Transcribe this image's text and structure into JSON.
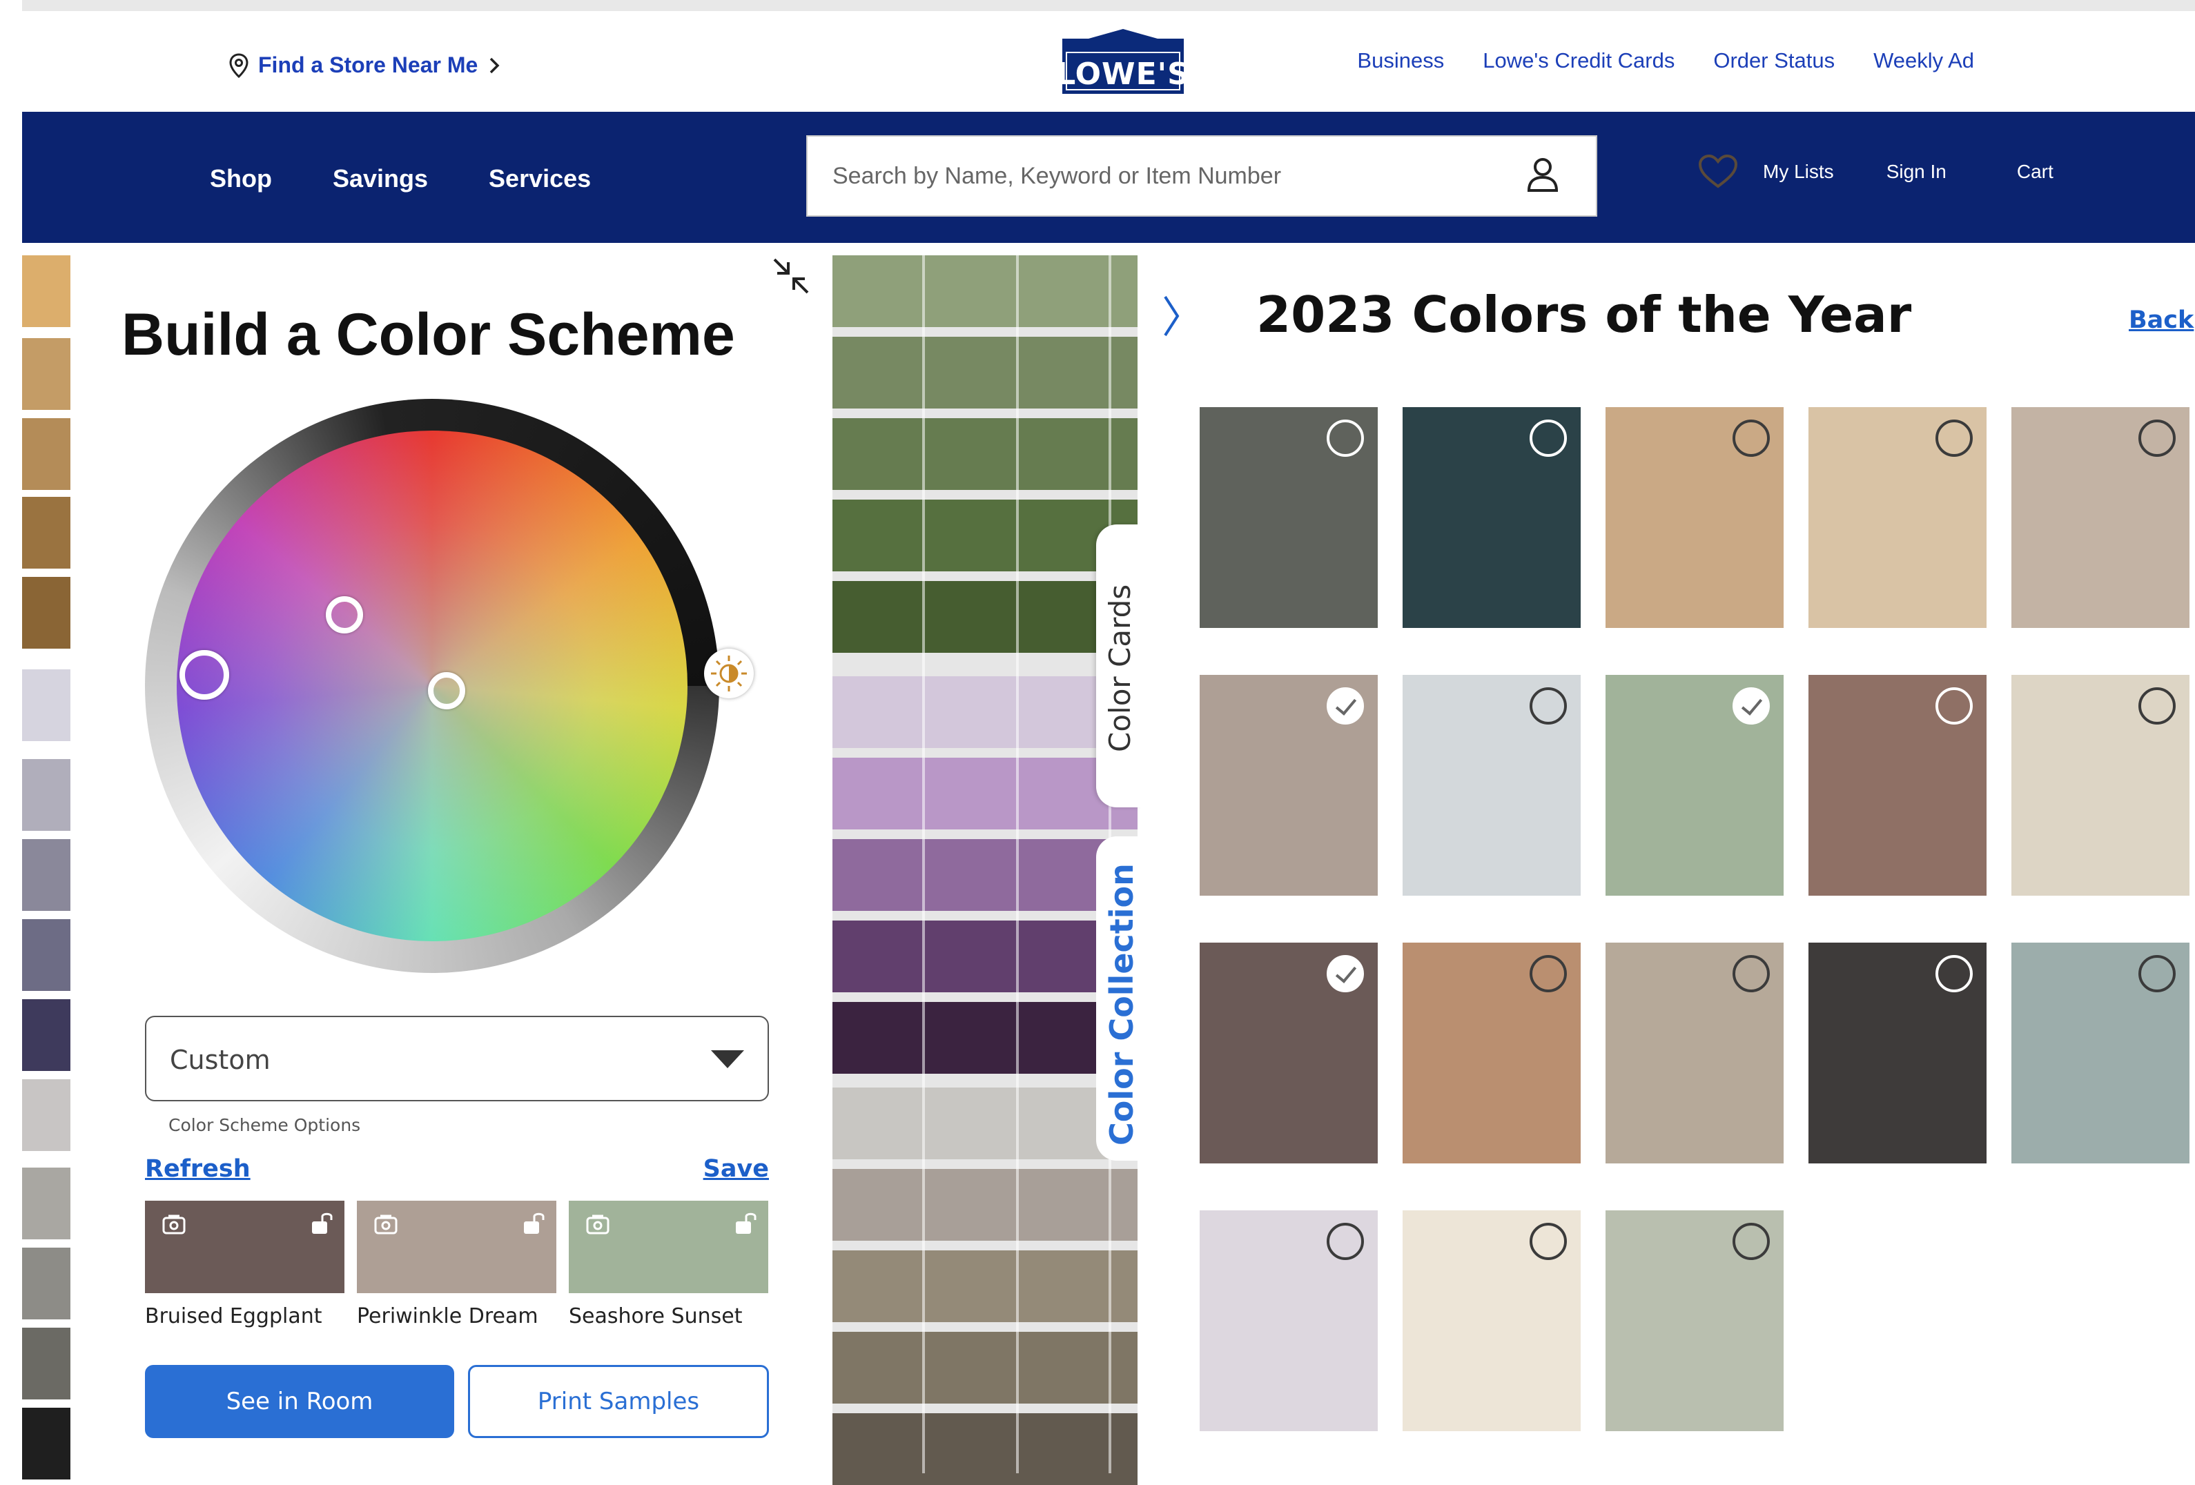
{
  "utility": {
    "store_link": "Find a Store Near Me",
    "logo": "LOWE'S",
    "links": [
      "Business",
      "Lowe's Credit Cards",
      "Order Status",
      "Weekly Ad"
    ]
  },
  "nav": {
    "items": [
      "Shop",
      "Savings",
      "Services"
    ],
    "search_placeholder": "Search by Name, Keyword or Item Number",
    "my_lists": "My Lists",
    "sign_in": "Sign In",
    "cart": "Cart"
  },
  "builder": {
    "title": "Build a Color Scheme",
    "scheme_select_value": "Custom",
    "scheme_select_label": "Color Scheme Options",
    "refresh": "Refresh",
    "save": "Save",
    "picks": [
      {
        "name": "Bruised Eggplant",
        "color": "#6b5a57"
      },
      {
        "name": "Periwinkle Dream",
        "color": "#ae9f95"
      },
      {
        "name": "Seashore Sunset",
        "color": "#a1b39a"
      }
    ],
    "see_in_room": "See in Room",
    "print_samples": "Print Samples"
  },
  "side_tabs": {
    "color_cards": "Color Cards",
    "color_collection": "Color Collection"
  },
  "collection": {
    "title": "2023 Colors of the Year",
    "back": "Back",
    "swatches": [
      {
        "color": "#5f625c",
        "selected": false
      },
      {
        "color": "#2b4248",
        "selected": false
      },
      {
        "color": "#caa985",
        "selected": false
      },
      {
        "color": "#d9c3a5",
        "selected": false
      },
      {
        "color": "#c3b3a4",
        "selected": false
      },
      {
        "color": "#ae9f95",
        "selected": true
      },
      {
        "color": "#d3d8db",
        "selected": false
      },
      {
        "color": "#a1b39a",
        "selected": true
      },
      {
        "color": "#8f7065",
        "selected": false
      },
      {
        "color": "#ddd5c5",
        "selected": false
      },
      {
        "color": "#6b5a57",
        "selected": true
      },
      {
        "color": "#ba8f70",
        "selected": false
      },
      {
        "color": "#b6a999",
        "selected": false
      },
      {
        "color": "#3e3b3a",
        "selected": false
      },
      {
        "color": "#9cadab",
        "selected": false
      },
      {
        "color": "#ddd7df",
        "selected": false
      },
      {
        "color": "#ede5d7",
        "selected": false
      },
      {
        "color": "#b9bfaf",
        "selected": false
      }
    ]
  },
  "left_strip_colors": [
    "#dcae6c",
    "#c49c66",
    "#b48c58",
    "#9a7340",
    "#8a6535",
    "#d6d4df",
    "#b0aebb",
    "#8a889a",
    "#6d6c85",
    "#3e3a5c",
    "#c8c5c4",
    "#a9a7a2",
    "#8d8c87",
    "#6b6a64",
    "#1f1f1f"
  ],
  "card_colors": [
    "#8fa07a",
    "#778962",
    "#667c50",
    "#56703f",
    "#465d30",
    "#d3c7db",
    "#b997c7",
    "#8f6a9d",
    "#613f6d",
    "#3b2340",
    "#c8c6c2",
    "#a89f98",
    "#948a78",
    "#7f7665",
    "#625a4f"
  ]
}
